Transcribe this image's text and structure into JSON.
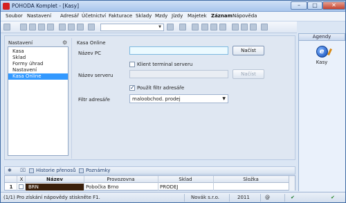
{
  "window": {
    "title": "POHODA Komplet - [Kasy]",
    "minimize": "–",
    "maximize": "□",
    "close": "✕"
  },
  "menu": [
    "Soubor",
    "Nastavení",
    "Adresář",
    "Účetnictví",
    "Fakturace",
    "Sklady",
    "Mzdy",
    "Jízdy",
    "Majetek",
    "Záznam",
    "Nápověda"
  ],
  "agendy": {
    "title": "Agendy",
    "item_label": "Kasy"
  },
  "settings": {
    "header": "Nastavení",
    "items": [
      "Kasa",
      "Sklad",
      "Formy úhrad",
      "Nastavení",
      "Kasa Online"
    ],
    "selected_index": 4
  },
  "form": {
    "section_title": "Kasa Online",
    "pc_label": "Název PC",
    "pc_value": "",
    "load_button": "Načíst",
    "terminal_label": "Klient terminal serveru",
    "terminal_checked": false,
    "server_label": "Název serveru",
    "server_value": "",
    "load_button2": "Načíst",
    "use_filter_label": "Použít filtr adresáře",
    "use_filter_checked": true,
    "filter_label": "Filtr adresáře",
    "filter_value": "maloobchod. prodej"
  },
  "bottom_tabs": [
    "Historie přenosů",
    "Poznámky"
  ],
  "grid": {
    "columns": [
      "X",
      "Název",
      "Provozovna",
      "Sklad",
      "Složka"
    ],
    "rows": [
      {
        "num": "1",
        "nazev": "BRN",
        "provozovna": "Pobočka Brno",
        "sklad": "PRODEJ",
        "slozka": ""
      }
    ]
  },
  "status": {
    "hint": "(1/1) Pro získání nápovědy stiskněte F1.",
    "company": "Novák s.r.o.",
    "year": "2011"
  }
}
